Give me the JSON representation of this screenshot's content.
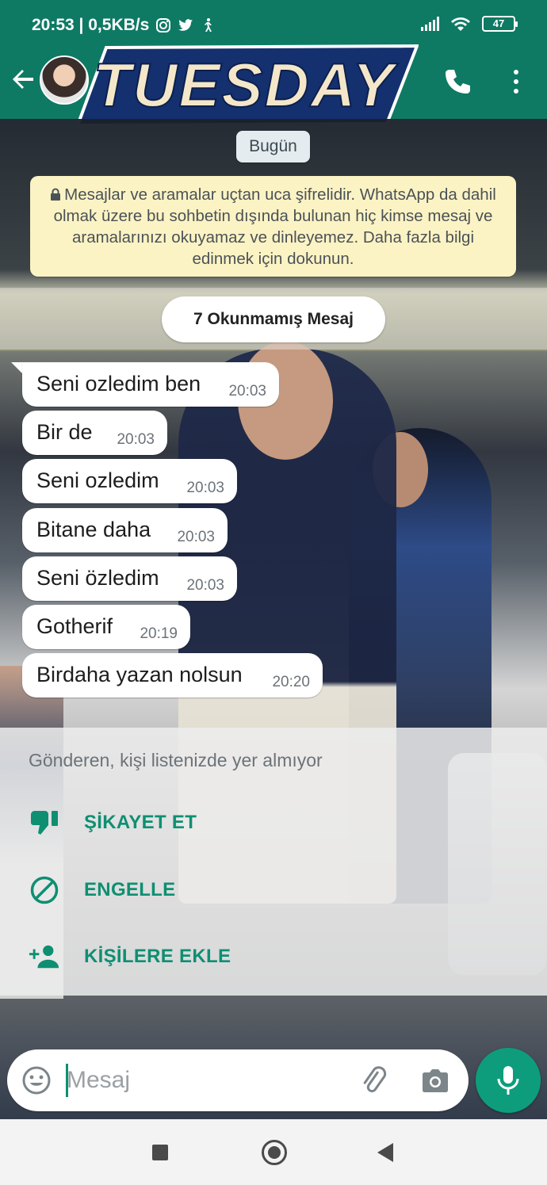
{
  "status_bar": {
    "time_speed": "20:53 | 0,5KB/s",
    "battery": "47",
    "icons": [
      "instagram-icon",
      "twitter-icon",
      "walk-icon",
      "signal-icon",
      "wifi-icon",
      "battery-icon"
    ]
  },
  "header": {
    "logo_text": "TUESDAY",
    "icons": [
      "back-arrow-icon",
      "avatar",
      "call-icon",
      "more-vert-icon"
    ]
  },
  "chat": {
    "date_chip": "Bugün",
    "encryption_notice": "Mesajlar ve aramalar uçtan uca şifrelidir. WhatsApp da dahil olmak üzere bu sohbetin dışında bulunan hiç kimse mesaj ve aramalarınızı okuyamaz ve dinleyemez. Daha fazla bilgi edinmek için dokunun.",
    "unread_label": "7 Okunmamış Mesaj",
    "messages": [
      {
        "text": "Seni ozledim ben",
        "time": "20:03"
      },
      {
        "text": "Bir de",
        "time": "20:03"
      },
      {
        "text": "Seni ozledim",
        "time": "20:03"
      },
      {
        "text": "Bitane daha",
        "time": "20:03"
      },
      {
        "text": "Seni özledim",
        "time": "20:03"
      },
      {
        "text": "Gotherif",
        "time": "20:19"
      },
      {
        "text": "Birdaha yazan nolsun",
        "time": "20:20"
      }
    ]
  },
  "stranger_panel": {
    "note": "Gönderen, kişi listenizde yer almıyor",
    "actions": [
      {
        "label": "ŞİKAYET ET",
        "icon": "thumb-down-icon"
      },
      {
        "label": "ENGELLE",
        "icon": "block-icon"
      },
      {
        "label": "KİŞİLERE EKLE",
        "icon": "add-contact-icon"
      }
    ]
  },
  "composer": {
    "placeholder": "Mesaj",
    "icons": [
      "emoji-icon",
      "attach-icon",
      "camera-icon",
      "mic-icon"
    ]
  },
  "colors": {
    "header": "#0e7a64",
    "accent": "#0e8f72",
    "mic_button": "#0e9d7c",
    "notice_bg": "#fcf3c4"
  }
}
